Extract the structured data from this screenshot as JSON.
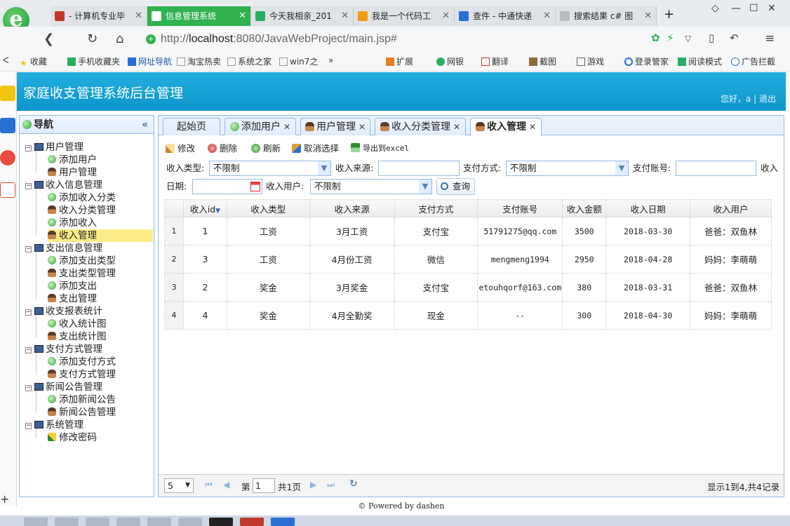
{
  "browser": {
    "tabs": [
      {
        "label": "- 计算机专业毕",
        "color": "#c0392b"
      },
      {
        "label": "信息管理系统",
        "color": "#ffffff"
      },
      {
        "label": "今天我相亲_201",
        "color": "#27ae60"
      },
      {
        "label": "我是一个代码工",
        "color": "#f39c12"
      },
      {
        "label": "查件 - 中通快递",
        "color": "#2a6fd6"
      },
      {
        "label": "搜索结果 c# 图",
        "color": "#bbbbbb"
      }
    ],
    "new_tab": "+",
    "url_prefix": "http://",
    "url_host": "localhost",
    "url_rest": ":8080/JavaWebProject/main.jsp#",
    "favorites": [
      "收藏",
      "手机收藏夹",
      "网址导航",
      "淘宝热卖",
      "系统之家",
      "win7之"
    ],
    "more": "»",
    "extensions": [
      "扩展",
      "网银",
      "翻译",
      "截图",
      "游戏",
      "登录管家",
      "阅读模式",
      "广告拦截"
    ]
  },
  "header": {
    "title": "家庭收支管理系统后台管理",
    "greeting": "您好，a | 退出"
  },
  "sidebar": {
    "title": "导航",
    "collapse": "«",
    "groups": [
      {
        "label": "用户管理",
        "items": [
          {
            "label": "添加用户",
            "icon": "add"
          },
          {
            "label": "用户管理",
            "icon": "user"
          }
        ]
      },
      {
        "label": "收入信息管理",
        "items": [
          {
            "label": "添加收入分类",
            "icon": "add"
          },
          {
            "label": "收入分类管理",
            "icon": "user"
          },
          {
            "label": "添加收入",
            "icon": "add"
          },
          {
            "label": "收入管理",
            "icon": "user"
          }
        ]
      },
      {
        "label": "支出信息管理",
        "items": [
          {
            "label": "添加支出类型",
            "icon": "add"
          },
          {
            "label": "支出类型管理",
            "icon": "user"
          },
          {
            "label": "添加支出",
            "icon": "add"
          },
          {
            "label": "支出管理",
            "icon": "user"
          }
        ]
      },
      {
        "label": "收支报表统计",
        "items": [
          {
            "label": "收入统计图",
            "icon": "add"
          },
          {
            "label": "支出统计图",
            "icon": "user"
          }
        ]
      },
      {
        "label": "支付方式管理",
        "items": [
          {
            "label": "添加支付方式",
            "icon": "add"
          },
          {
            "label": "支付方式管理",
            "icon": "user"
          }
        ]
      },
      {
        "label": "新闻公告管理",
        "items": [
          {
            "label": "添加新闻公告",
            "icon": "add"
          },
          {
            "label": "新闻公告管理",
            "icon": "user"
          }
        ]
      },
      {
        "label": "系统管理",
        "items": [
          {
            "label": "修改密码",
            "icon": "pen"
          }
        ]
      }
    ],
    "selected": "收入管理"
  },
  "tabs": [
    "起始页",
    "添加用户",
    "用户管理",
    "收入分类管理",
    "收入管理"
  ],
  "toolbar": {
    "edit": "修改",
    "delete": "删除",
    "refresh": "刷新",
    "unselect": "取消选择",
    "export": "导出到excel"
  },
  "filters": {
    "type_label": "收入类型:",
    "type_value": "不限制",
    "source_label": "收入来源:",
    "source_value": "",
    "pay_label": "支付方式:",
    "pay_value": "不限制",
    "account_label": "支付账号:",
    "account_value": "",
    "cut_label": "收入",
    "date_label": "日期:",
    "date_value": "",
    "user_label": "收入用户:",
    "user_value": "不限制",
    "query": "查询"
  },
  "grid": {
    "columns": [
      "收入id",
      "收入类型",
      "收入来源",
      "支付方式",
      "支付账号",
      "收入金额",
      "收入日期",
      "收入用户"
    ],
    "sort_indicator": "▼",
    "rows": [
      [
        "1",
        "1",
        "工资",
        "3月工资",
        "支付宝",
        "51791275@qq.com",
        "3500",
        "2018-03-30",
        "爸爸：双鱼林"
      ],
      [
        "2",
        "3",
        "工资",
        "4月份工资",
        "微信",
        "mengmeng1994",
        "2950",
        "2018-04-28",
        "妈妈：李萌萌"
      ],
      [
        "3",
        "2",
        "奖金",
        "3月奖金",
        "支付宝",
        "etouhqorf@163.com",
        "380",
        "2018-03-31",
        "爸爸：双鱼林"
      ],
      [
        "4",
        "4",
        "奖金",
        "4月全勤奖",
        "现金",
        "--",
        "300",
        "2018-04-30",
        "妈妈：李萌萌"
      ]
    ]
  },
  "pager": {
    "page_size": "5",
    "first": "⏮",
    "prev": "◀",
    "next": "▶",
    "last": "⏭",
    "reload": "↻",
    "page_label": "第",
    "page_value": "1",
    "total_pages": "共1页",
    "summary": "显示1到4,共4记录"
  },
  "footer": "© Powered by dashen"
}
